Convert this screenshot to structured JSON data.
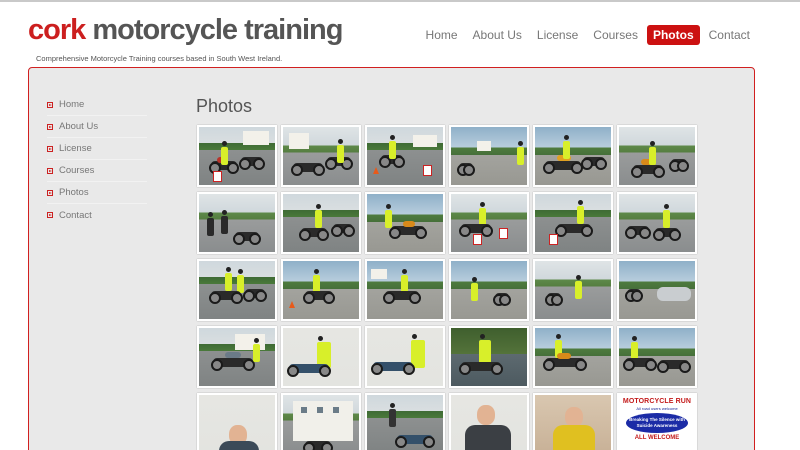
{
  "brand": {
    "name_first": "cork",
    "name_rest": " motorcycle training",
    "tagline": "Comprehensive Motorcycle Training courses based in South West Ireland."
  },
  "colors": {
    "accent": "#cc1111",
    "panel_bg": "#e9e9e9",
    "text_grey": "#777777"
  },
  "nav": {
    "items": [
      {
        "label": "Home"
      },
      {
        "label": "About Us"
      },
      {
        "label": "License"
      },
      {
        "label": "Courses"
      },
      {
        "label": "Photos",
        "active": true
      },
      {
        "label": "Contact"
      }
    ]
  },
  "sidebar": {
    "items": [
      {
        "label": "Home"
      },
      {
        "label": "About Us"
      },
      {
        "label": "License"
      },
      {
        "label": "Courses"
      },
      {
        "label": "Photos"
      },
      {
        "label": "Contact"
      }
    ]
  },
  "page": {
    "title": "Photos"
  },
  "poster": {
    "title": "MOTORCYCLE RUN",
    "subtitle": "All road users welcome",
    "oval": "Breaking The Silence with Suicide Awareness",
    "footer": "ALL WELCOME"
  }
}
